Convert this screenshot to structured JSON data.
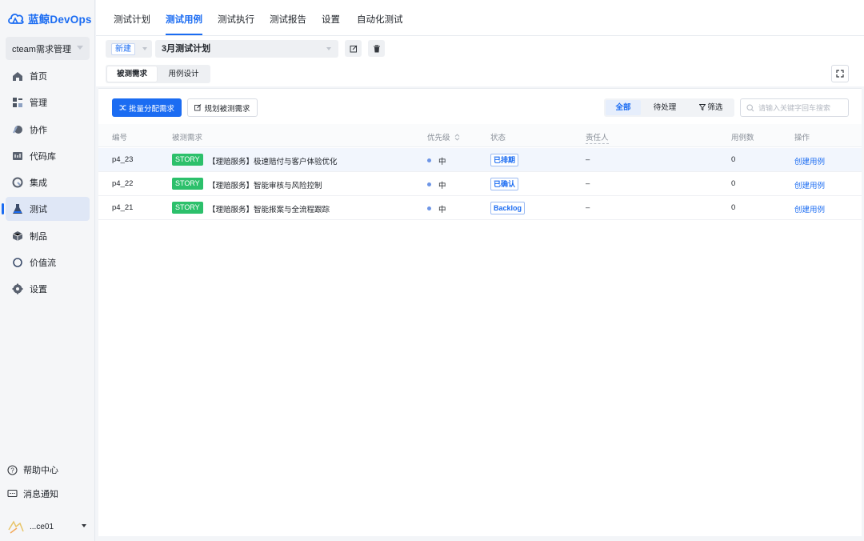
{
  "app": {
    "logo_text": "蓝鲸DevOps"
  },
  "sidebar": {
    "project": "cteam需求管理",
    "items": [
      {
        "label": "首页",
        "icon": "home-icon",
        "active": false
      },
      {
        "label": "管理",
        "icon": "manage-icon",
        "active": false
      },
      {
        "label": "协作",
        "icon": "collaborate-icon",
        "active": false
      },
      {
        "label": "代码库",
        "icon": "code-repo-icon",
        "active": false
      },
      {
        "label": "集成",
        "icon": "integration-icon",
        "active": false
      },
      {
        "label": "测试",
        "icon": "test-flask-icon",
        "active": true
      },
      {
        "label": "制品",
        "icon": "artifact-icon",
        "active": false
      },
      {
        "label": "价值流",
        "icon": "value-stream-icon",
        "active": false
      },
      {
        "label": "设置",
        "icon": "settings-gear-icon",
        "active": false
      }
    ],
    "bottom": [
      {
        "label": "帮助中心",
        "icon": "help-icon"
      },
      {
        "label": "消息通知",
        "icon": "message-icon"
      }
    ],
    "user_name": "...ce01"
  },
  "top_tabs": [
    {
      "label": "测试计划",
      "active": false
    },
    {
      "label": "测试用例",
      "active": true
    },
    {
      "label": "测试执行",
      "active": false
    },
    {
      "label": "测试报告",
      "active": false
    },
    {
      "label": "设置",
      "active": false
    },
    {
      "label": "自动化测试",
      "active": false
    }
  ],
  "toolbar": {
    "new_label": "新建",
    "plan_name": "3月测试计划",
    "segments": [
      "被测需求",
      "用例设计"
    ],
    "active_segment": "被测需求"
  },
  "actions": {
    "batch_assign": "批量分配需求",
    "plan_requirements": "规划被测需求",
    "filters": [
      "全部",
      "待处理",
      "筛选"
    ],
    "active_filter": "全部",
    "search_placeholder": "请输入关键字回车搜索"
  },
  "table": {
    "headers": [
      "编号",
      "被测需求",
      "优先级",
      "状态",
      "责任人",
      "用例数",
      "操作"
    ],
    "rows": [
      {
        "id": "p4_23",
        "type": "STORY",
        "title": "【理赔服务】极速赔付与客户体验优化",
        "priority": "中",
        "status": "已排期",
        "owner": "–",
        "cases": "0",
        "action": "创建用例"
      },
      {
        "id": "p4_22",
        "type": "STORY",
        "title": "【理赔服务】智能审核与风险控制",
        "priority": "中",
        "status": "已确认",
        "owner": "–",
        "cases": "0",
        "action": "创建用例"
      },
      {
        "id": "p4_21",
        "type": "STORY",
        "title": "【理赔服务】智能报案与全流程跟踪",
        "priority": "中",
        "status": "Backlog",
        "owner": "–",
        "cases": "0",
        "action": "创建用例"
      }
    ]
  },
  "colors": {
    "accent": "#1b6cf2",
    "story": "#2cc06b",
    "priority": "#6e95e6"
  }
}
